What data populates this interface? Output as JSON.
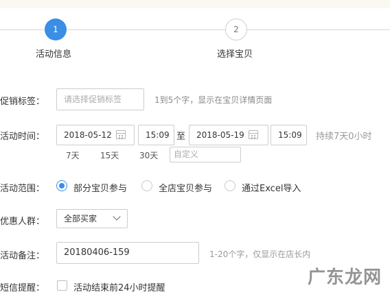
{
  "steps": [
    {
      "number": "1",
      "label": "活动信息",
      "active": true
    },
    {
      "number": "2",
      "label": "选择宝贝",
      "active": false
    }
  ],
  "promo_tag": {
    "label": "促销标签：",
    "placeholder": "请选择促销标签",
    "hint": "1到5个字，显示在宝贝详情页面"
  },
  "activity_time": {
    "label": "活动时间：",
    "start_date": "2018-05-12",
    "start_time": "15:09",
    "separator": "至",
    "end_date": "2018-05-19",
    "end_time": "15:09",
    "duration": "持续7天0小时",
    "quick_options": [
      "7天",
      "15天",
      "30天"
    ],
    "custom_placeholder": "自定义"
  },
  "activity_scope": {
    "label": "活动范围：",
    "options": [
      "部分宝贝参与",
      "全店宝贝参与",
      "通过Excel导入"
    ],
    "selected": "部分宝贝参与"
  },
  "audience": {
    "label": "优惠人群：",
    "selected": "全部买家"
  },
  "activity_note": {
    "label": "活动备注：",
    "value": "20180406-159",
    "hint": "1-20个字，仅显示在店长内"
  },
  "sms_reminder": {
    "label": "短信提醒：",
    "option": "活动结束前24小时提醒",
    "checked": false
  },
  "watermark": "广东龙网",
  "colors": {
    "accent": "#3a8ee6",
    "border": "#cccccc",
    "hint": "#999999"
  }
}
